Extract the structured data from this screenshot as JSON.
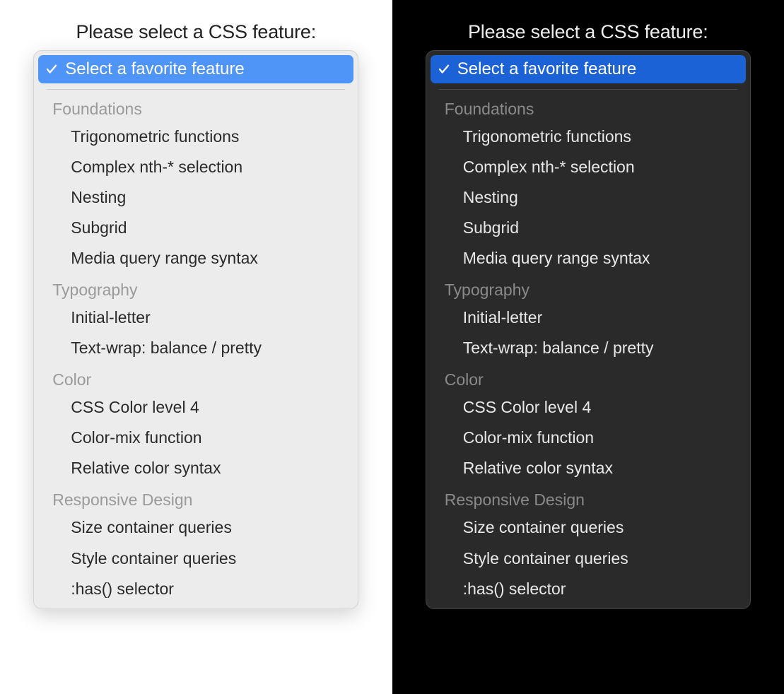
{
  "prompt": "Please select a CSS feature:",
  "select": {
    "selected_label": "Select a favorite feature",
    "check_icon_name": "check-icon",
    "groups": [
      {
        "label": "Foundations",
        "options": [
          "Trigonometric functions",
          "Complex nth-* selection",
          "Nesting",
          "Subgrid",
          "Media query range syntax"
        ]
      },
      {
        "label": "Typography",
        "options": [
          "Initial-letter",
          "Text-wrap: balance / pretty"
        ]
      },
      {
        "label": "Color",
        "options": [
          "CSS Color level 4",
          "Color-mix function",
          "Relative color syntax"
        ]
      },
      {
        "label": "Responsive Design",
        "options": [
          "Size container queries",
          "Style container queries",
          ":has() selector"
        ]
      }
    ]
  },
  "colors": {
    "light_bg": "#ffffff",
    "dark_bg": "#000000",
    "light_popup_bg": "#ececec",
    "dark_popup_bg": "#2a2a2a",
    "light_highlight": "#4f94f7",
    "dark_highlight": "#1a62d6",
    "light_group_header": "#9a9a9a",
    "dark_group_header": "#8a8a8a"
  }
}
